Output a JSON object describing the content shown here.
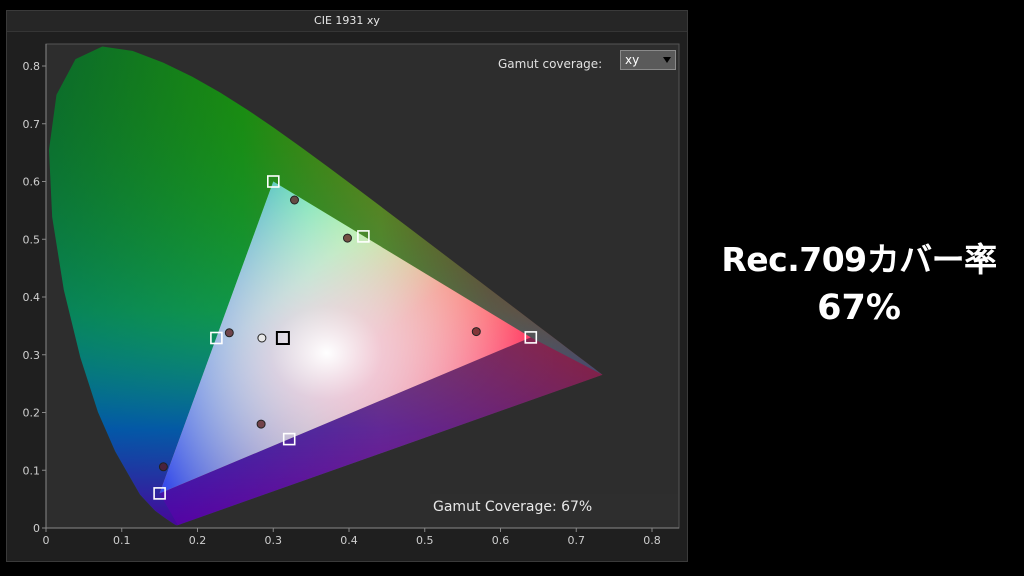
{
  "panel": {
    "title": "CIE 1931 xy",
    "gamut_dropdown_label": "Gamut coverage:",
    "gamut_dropdown_value": "xy",
    "coverage_text": "Gamut Coverage:  67%"
  },
  "headline": {
    "line1": "Rec.709カバー率",
    "line2": "67%"
  },
  "chart_data": {
    "type": "scatter",
    "title": "CIE 1931 xy",
    "xlabel": "",
    "ylabel": "",
    "xlim": [
      0,
      0.8
    ],
    "ylim": [
      0,
      0.8
    ],
    "x_ticks": [
      "0",
      "0.1",
      "0.2",
      "0.3",
      "0.4",
      "0.5",
      "0.6",
      "0.7",
      "0.8"
    ],
    "y_ticks": [
      "0",
      "0.1",
      "0.2",
      "0.3",
      "0.4",
      "0.5",
      "0.6",
      "0.7",
      "0.8"
    ],
    "grid": false,
    "series": [
      {
        "marker": "square",
        "points": [
          {
            "x": 0.64,
            "y": 0.33
          },
          {
            "x": 0.3,
            "y": 0.6
          },
          {
            "x": 0.15,
            "y": 0.06
          },
          {
            "x": 0.225,
            "y": 0.329
          },
          {
            "x": 0.321,
            "y": 0.154
          },
          {
            "x": 0.419,
            "y": 0.505
          },
          {
            "x": 0.3127,
            "y": 0.329
          }
        ]
      },
      {
        "marker": "circle",
        "points": [
          {
            "x": 0.568,
            "y": 0.34
          },
          {
            "x": 0.328,
            "y": 0.568
          },
          {
            "x": 0.155,
            "y": 0.106
          },
          {
            "x": 0.242,
            "y": 0.338
          },
          {
            "x": 0.284,
            "y": 0.18
          },
          {
            "x": 0.398,
            "y": 0.502
          },
          {
            "x": 0.285,
            "y": 0.329
          }
        ]
      }
    ],
    "measured_gamut_coverage": "67%",
    "colors": {
      "reference_marker": "#ffffff",
      "measured_marker": "#5a1a1a",
      "white_point_marker": "#000000"
    }
  }
}
